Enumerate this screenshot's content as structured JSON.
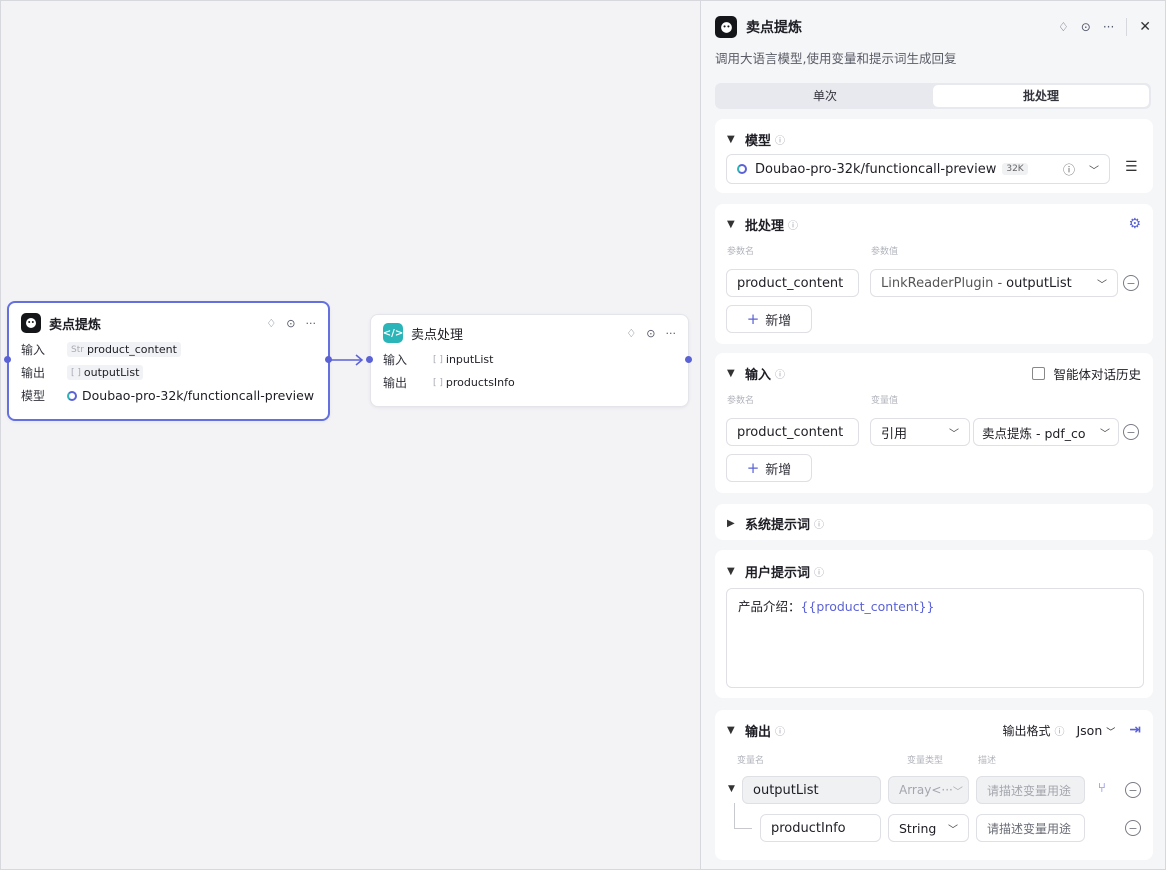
{
  "canvas": {
    "node1": {
      "title": "卖点提炼",
      "rows": [
        {
          "label": "输入",
          "type_tag": "Str",
          "value": "product_content"
        },
        {
          "label": "输出",
          "type_tag": "[ ]",
          "value": "outputList"
        },
        {
          "label": "模型",
          "value": "Doubao-pro-32k/functioncall-preview"
        }
      ]
    },
    "node2": {
      "title": "卖点处理",
      "rows": [
        {
          "label": "输入",
          "type_tag": "[ ]",
          "value": "inputList"
        },
        {
          "label": "输出",
          "type_tag": "[ ]",
          "value": "productsInfo"
        }
      ]
    }
  },
  "panel": {
    "title": "卖点提炼",
    "description": "调用大语言模型,使用变量和提示词生成回复",
    "tabs": [
      "单次",
      "批处理"
    ],
    "active_tab": "批处理",
    "model_section": {
      "title": "模型",
      "model_name": "Doubao-pro-32k/functioncall-preview",
      "badge": "32K"
    },
    "batch_section": {
      "title": "批处理",
      "col_param": "参数名",
      "col_value": "参数值",
      "param_name": "product_content",
      "param_value_source": "LinkReaderPlugin",
      "param_value_var": "outputList",
      "add_label": "新增"
    },
    "input_section": {
      "title": "输入",
      "history_label": "智能体对话历史",
      "col_param": "参数名",
      "col_value": "变量值",
      "param_name": "product_content",
      "ref_type": "引用",
      "ref_value": "卖点提炼 - pdf_co",
      "add_label": "新增"
    },
    "system_prompt": {
      "title": "系统提示词"
    },
    "user_prompt": {
      "title": "用户提示词",
      "prefix": "产品介绍：",
      "variable": "{{product_content}}"
    },
    "output_section": {
      "title": "输出",
      "format_label": "输出格式",
      "format_value": "Json",
      "col_var": "变量名",
      "col_type": "变量类型",
      "col_desc": "描述",
      "rows": [
        {
          "name": "outputList",
          "type": "Array<···",
          "desc_placeholder": "请描述变量用途"
        },
        {
          "name": "productInfo",
          "type": "String",
          "desc_placeholder": "请描述变量用途"
        }
      ]
    }
  },
  "colors": {
    "accent": "#5b62d6",
    "selected_border": "#6470e0",
    "code_icon": "#2bb5b8"
  }
}
